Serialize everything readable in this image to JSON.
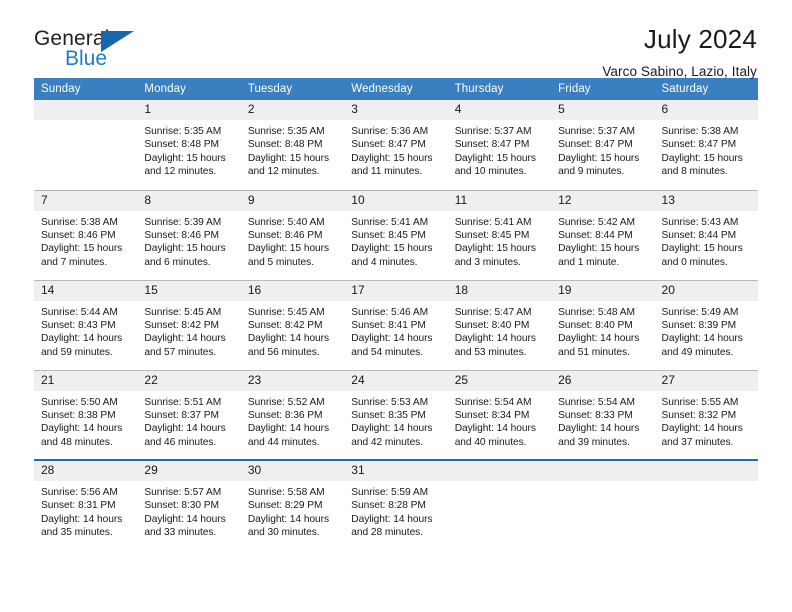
{
  "logo": {
    "word_top": "General",
    "word_bottom": "Blue",
    "accent_color": "#1667ad"
  },
  "header": {
    "title": "July 2024",
    "subtitle": "Varco Sabino, Lazio, Italy"
  },
  "calendar": {
    "header_color": "#3a7fbf",
    "daynum_band_color": "#efefef",
    "weekdays": [
      "Sunday",
      "Monday",
      "Tuesday",
      "Wednesday",
      "Thursday",
      "Friday",
      "Saturday"
    ],
    "weeks": [
      [
        {
          "day": "",
          "lines": []
        },
        {
          "day": "1",
          "lines": [
            "Sunrise: 5:35 AM",
            "Sunset: 8:48 PM",
            "Daylight: 15 hours",
            "and 12 minutes."
          ]
        },
        {
          "day": "2",
          "lines": [
            "Sunrise: 5:35 AM",
            "Sunset: 8:48 PM",
            "Daylight: 15 hours",
            "and 12 minutes."
          ]
        },
        {
          "day": "3",
          "lines": [
            "Sunrise: 5:36 AM",
            "Sunset: 8:47 PM",
            "Daylight: 15 hours",
            "and 11 minutes."
          ]
        },
        {
          "day": "4",
          "lines": [
            "Sunrise: 5:37 AM",
            "Sunset: 8:47 PM",
            "Daylight: 15 hours",
            "and 10 minutes."
          ]
        },
        {
          "day": "5",
          "lines": [
            "Sunrise: 5:37 AM",
            "Sunset: 8:47 PM",
            "Daylight: 15 hours",
            "and 9 minutes."
          ]
        },
        {
          "day": "6",
          "lines": [
            "Sunrise: 5:38 AM",
            "Sunset: 8:47 PM",
            "Daylight: 15 hours",
            "and 8 minutes."
          ]
        }
      ],
      [
        {
          "day": "7",
          "lines": [
            "Sunrise: 5:38 AM",
            "Sunset: 8:46 PM",
            "Daylight: 15 hours",
            "and 7 minutes."
          ]
        },
        {
          "day": "8",
          "lines": [
            "Sunrise: 5:39 AM",
            "Sunset: 8:46 PM",
            "Daylight: 15 hours",
            "and 6 minutes."
          ]
        },
        {
          "day": "9",
          "lines": [
            "Sunrise: 5:40 AM",
            "Sunset: 8:46 PM",
            "Daylight: 15 hours",
            "and 5 minutes."
          ]
        },
        {
          "day": "10",
          "lines": [
            "Sunrise: 5:41 AM",
            "Sunset: 8:45 PM",
            "Daylight: 15 hours",
            "and 4 minutes."
          ]
        },
        {
          "day": "11",
          "lines": [
            "Sunrise: 5:41 AM",
            "Sunset: 8:45 PM",
            "Daylight: 15 hours",
            "and 3 minutes."
          ]
        },
        {
          "day": "12",
          "lines": [
            "Sunrise: 5:42 AM",
            "Sunset: 8:44 PM",
            "Daylight: 15 hours",
            "and 1 minute."
          ]
        },
        {
          "day": "13",
          "lines": [
            "Sunrise: 5:43 AM",
            "Sunset: 8:44 PM",
            "Daylight: 15 hours",
            "and 0 minutes."
          ]
        }
      ],
      [
        {
          "day": "14",
          "lines": [
            "Sunrise: 5:44 AM",
            "Sunset: 8:43 PM",
            "Daylight: 14 hours",
            "and 59 minutes."
          ]
        },
        {
          "day": "15",
          "lines": [
            "Sunrise: 5:45 AM",
            "Sunset: 8:42 PM",
            "Daylight: 14 hours",
            "and 57 minutes."
          ]
        },
        {
          "day": "16",
          "lines": [
            "Sunrise: 5:45 AM",
            "Sunset: 8:42 PM",
            "Daylight: 14 hours",
            "and 56 minutes."
          ]
        },
        {
          "day": "17",
          "lines": [
            "Sunrise: 5:46 AM",
            "Sunset: 8:41 PM",
            "Daylight: 14 hours",
            "and 54 minutes."
          ]
        },
        {
          "day": "18",
          "lines": [
            "Sunrise: 5:47 AM",
            "Sunset: 8:40 PM",
            "Daylight: 14 hours",
            "and 53 minutes."
          ]
        },
        {
          "day": "19",
          "lines": [
            "Sunrise: 5:48 AM",
            "Sunset: 8:40 PM",
            "Daylight: 14 hours",
            "and 51 minutes."
          ]
        },
        {
          "day": "20",
          "lines": [
            "Sunrise: 5:49 AM",
            "Sunset: 8:39 PM",
            "Daylight: 14 hours",
            "and 49 minutes."
          ]
        }
      ],
      [
        {
          "day": "21",
          "lines": [
            "Sunrise: 5:50 AM",
            "Sunset: 8:38 PM",
            "Daylight: 14 hours",
            "and 48 minutes."
          ]
        },
        {
          "day": "22",
          "lines": [
            "Sunrise: 5:51 AM",
            "Sunset: 8:37 PM",
            "Daylight: 14 hours",
            "and 46 minutes."
          ]
        },
        {
          "day": "23",
          "lines": [
            "Sunrise: 5:52 AM",
            "Sunset: 8:36 PM",
            "Daylight: 14 hours",
            "and 44 minutes."
          ]
        },
        {
          "day": "24",
          "lines": [
            "Sunrise: 5:53 AM",
            "Sunset: 8:35 PM",
            "Daylight: 14 hours",
            "and 42 minutes."
          ]
        },
        {
          "day": "25",
          "lines": [
            "Sunrise: 5:54 AM",
            "Sunset: 8:34 PM",
            "Daylight: 14 hours",
            "and 40 minutes."
          ]
        },
        {
          "day": "26",
          "lines": [
            "Sunrise: 5:54 AM",
            "Sunset: 8:33 PM",
            "Daylight: 14 hours",
            "and 39 minutes."
          ]
        },
        {
          "day": "27",
          "lines": [
            "Sunrise: 5:55 AM",
            "Sunset: 8:32 PM",
            "Daylight: 14 hours",
            "and 37 minutes."
          ]
        }
      ],
      [
        {
          "day": "28",
          "lines": [
            "Sunrise: 5:56 AM",
            "Sunset: 8:31 PM",
            "Daylight: 14 hours",
            "and 35 minutes."
          ]
        },
        {
          "day": "29",
          "lines": [
            "Sunrise: 5:57 AM",
            "Sunset: 8:30 PM",
            "Daylight: 14 hours",
            "and 33 minutes."
          ]
        },
        {
          "day": "30",
          "lines": [
            "Sunrise: 5:58 AM",
            "Sunset: 8:29 PM",
            "Daylight: 14 hours",
            "and 30 minutes."
          ]
        },
        {
          "day": "31",
          "lines": [
            "Sunrise: 5:59 AM",
            "Sunset: 8:28 PM",
            "Daylight: 14 hours",
            "and 28 minutes."
          ]
        },
        {
          "day": "",
          "lines": []
        },
        {
          "day": "",
          "lines": []
        },
        {
          "day": "",
          "lines": []
        }
      ]
    ]
  }
}
